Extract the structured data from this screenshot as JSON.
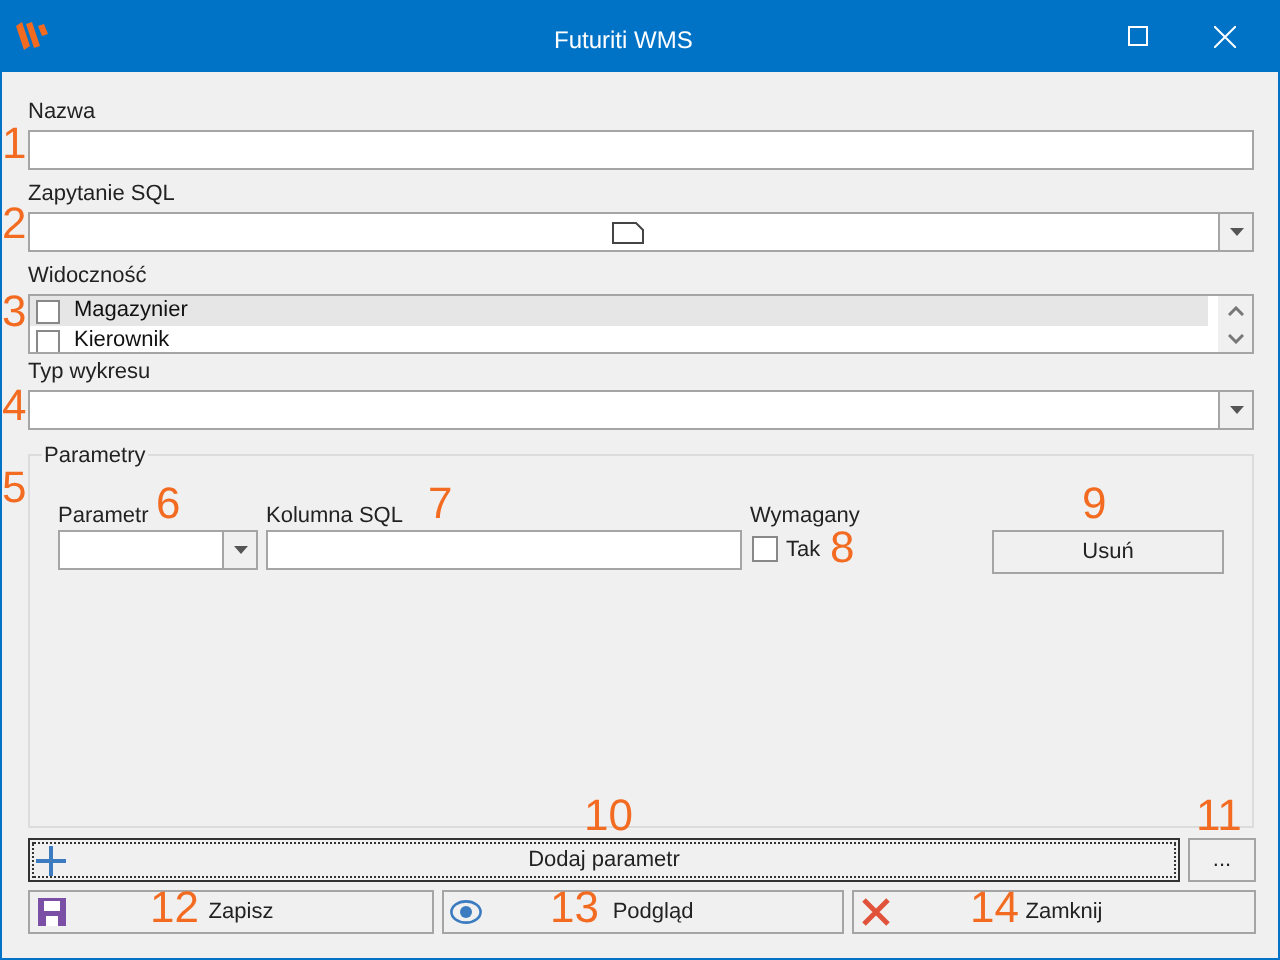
{
  "window": {
    "title": "Futuriti WMS"
  },
  "fields": [
    {
      "label": "Nazwa",
      "kind": "text"
    },
    {
      "label": "Zapytanie SQL",
      "kind": "combo-doc"
    },
    {
      "label": "Widoczność",
      "kind": "checklist",
      "items": [
        {
          "label": "Magazynier",
          "checked": false,
          "selected": true
        },
        {
          "label": "Kierownik",
          "checked": false,
          "selected": false
        }
      ]
    },
    {
      "label": "Typ wykresu",
      "kind": "combo"
    }
  ],
  "parameters": {
    "title": "Parametry",
    "parameter_label": "Parametr",
    "column_label": "Kolumna SQL",
    "required_label": "Wymagany",
    "required_option": {
      "label": "Tak",
      "checked": false
    },
    "remove_button": "Usuń"
  },
  "add_button": "Dodaj parametr",
  "more_button": "...",
  "buttons": [
    {
      "label": "Zapisz",
      "kind": "save"
    },
    {
      "label": "Podgląd",
      "kind": "preview"
    },
    {
      "label": "Zamknij",
      "kind": "close"
    }
  ],
  "annotations": [
    "1",
    "2",
    "3",
    "4",
    "5",
    "6",
    "7",
    "8",
    "9",
    "10",
    "11",
    "12",
    "13",
    "14"
  ]
}
